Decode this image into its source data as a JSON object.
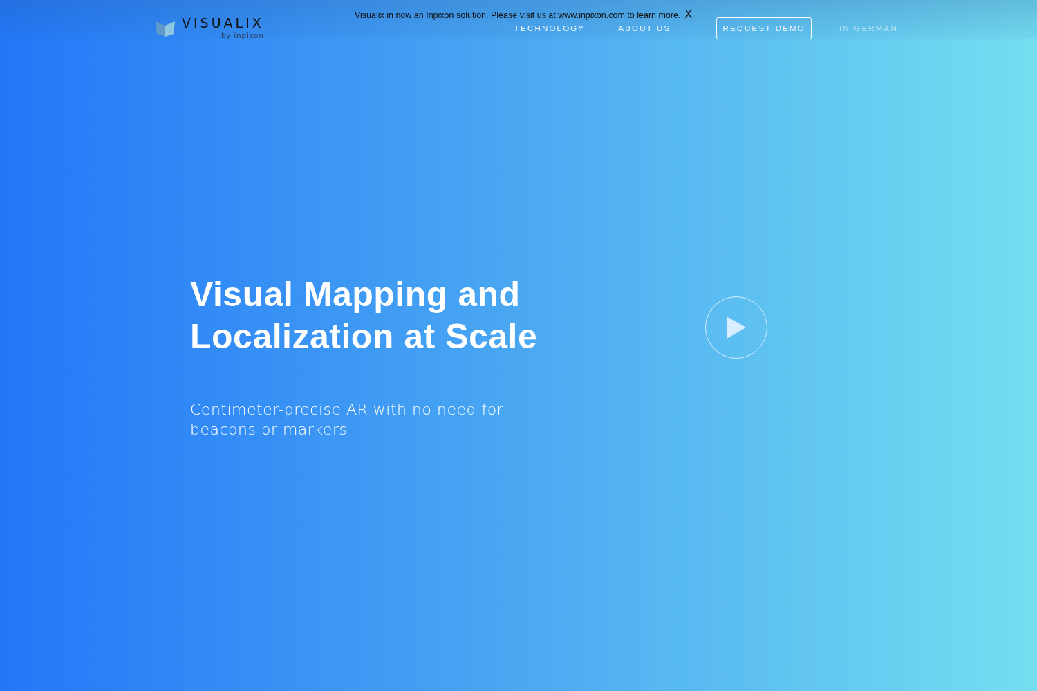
{
  "banner": {
    "text": "Visualix in now an Inpixon solution. Please visit us at www.inpixon.com to learn more.",
    "close": "X"
  },
  "logo": {
    "name": "VISUALIX",
    "tagline": "by inpixon"
  },
  "nav": [
    {
      "label": "TECHNOLOGY",
      "kind": "link"
    },
    {
      "label": "ABOUT US",
      "kind": "link"
    },
    {
      "label": "REQUEST DEMO",
      "kind": "button"
    },
    {
      "label": "IN GERMAN",
      "kind": "muted"
    }
  ],
  "hero": {
    "title_lines": [
      "Visual Mapping and",
      "Localization at Scale"
    ],
    "subtitle": "Centimeter-precise AR with no need for beacons or markers"
  }
}
